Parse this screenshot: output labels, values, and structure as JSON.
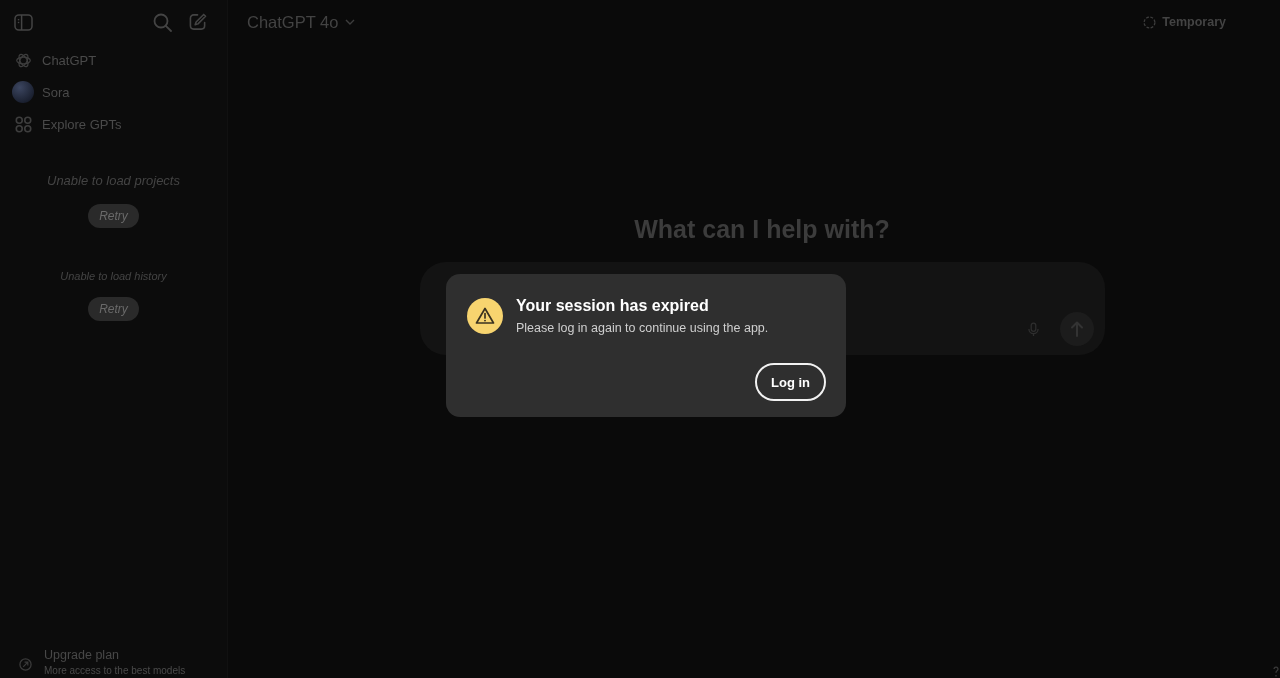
{
  "sidebar": {
    "nav_items": [
      {
        "label": "ChatGPT",
        "kind": "logo"
      },
      {
        "label": "Sora",
        "kind": "avatar"
      },
      {
        "label": "Explore GPTs",
        "kind": "grid"
      }
    ],
    "sections": [
      {
        "kind": "projects",
        "message": "Unable to load projects",
        "button": "Retry"
      },
      {
        "kind": "history",
        "message": "Unable to load history",
        "button": "Retry"
      }
    ],
    "upgrade": {
      "title": "Upgrade plan",
      "subtitle": "More access to the best models"
    }
  },
  "header": {
    "model": "ChatGPT 4o",
    "temporary": "Temporary"
  },
  "main": {
    "heading": "What can I help with?"
  },
  "dialog": {
    "title": "Your session has expired",
    "message": "Please log in again to continue using the app.",
    "button": "Log in"
  }
}
